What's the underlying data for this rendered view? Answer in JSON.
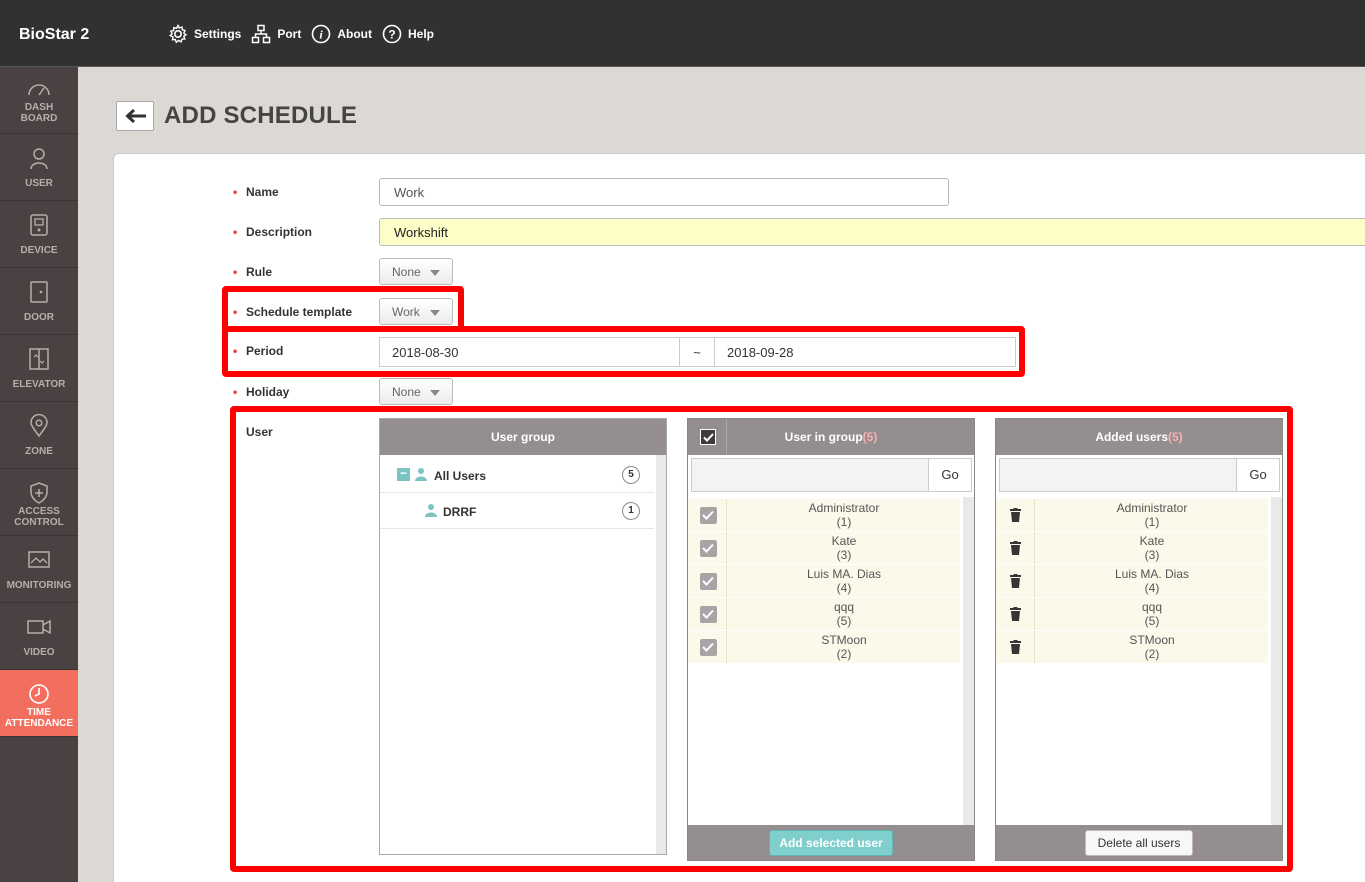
{
  "app": {
    "title": "BioStar 2"
  },
  "topnav": {
    "settings": "Settings",
    "port": "Port",
    "about": "About",
    "help": "Help"
  },
  "sidebar": {
    "items": [
      {
        "line1": "DASH",
        "line2": "BOARD",
        "icon": "dashboard-icon"
      },
      {
        "line1": "USER",
        "line2": "",
        "icon": "user-icon"
      },
      {
        "line1": "DEVICE",
        "line2": "",
        "icon": "device-icon"
      },
      {
        "line1": "DOOR",
        "line2": "",
        "icon": "door-icon"
      },
      {
        "line1": "ELEVATOR",
        "line2": "",
        "icon": "elevator-icon"
      },
      {
        "line1": "ZONE",
        "line2": "",
        "icon": "zone-icon"
      },
      {
        "line1": "ACCESS",
        "line2": "CONTROL",
        "icon": "access-control-icon"
      },
      {
        "line1": "MONITORING",
        "line2": "",
        "icon": "monitoring-icon"
      },
      {
        "line1": "VIDEO",
        "line2": "",
        "icon": "video-icon"
      },
      {
        "line1": "TIME",
        "line2": "ATTENDANCE",
        "icon": "clock-icon",
        "active": true
      }
    ]
  },
  "page": {
    "title": "ADD SCHEDULE"
  },
  "form": {
    "name_label": "Name",
    "name_value": "Work",
    "description_label": "Description",
    "description_value": "Workshift",
    "rule_label": "Rule",
    "rule_value": "None",
    "template_label": "Schedule template",
    "template_value": "Work",
    "period_label": "Period",
    "period_start": "2018-08-30",
    "period_sep": "~",
    "period_end": "2018-09-28",
    "holiday_label": "Holiday",
    "holiday_value": "None",
    "user_label": "User",
    "required_mark": "•"
  },
  "user_group": {
    "header": "User group",
    "tree": [
      {
        "label": "All Users",
        "count": "5",
        "collapse": "−"
      },
      {
        "label": "DRRF",
        "count": "1"
      }
    ]
  },
  "user_in_group": {
    "header": "User in group",
    "count": "(5)",
    "go_label": "Go",
    "users": [
      {
        "name": "Administrator",
        "id": "(1)"
      },
      {
        "name": "Kate",
        "id": "(3)"
      },
      {
        "name": "Luis MA. Dias",
        "id": "(4)"
      },
      {
        "name": "qqq",
        "id": "(5)"
      },
      {
        "name": "STMoon",
        "id": "(2)"
      }
    ],
    "button": "Add selected user"
  },
  "added_users": {
    "header": "Added users",
    "count": "(5)",
    "go_label": "Go",
    "users": [
      {
        "name": "Administrator",
        "id": "(1)"
      },
      {
        "name": "Kate",
        "id": "(3)"
      },
      {
        "name": "Luis MA. Dias",
        "id": "(4)"
      },
      {
        "name": "qqq",
        "id": "(5)"
      },
      {
        "name": "STMoon",
        "id": "(2)"
      }
    ],
    "button": "Delete all users"
  },
  "colors": {
    "topbar": "#333030",
    "sidebar": "#4a4142",
    "active": "#f26f5f",
    "highlight": "#ff0000",
    "header_gray": "#958e90",
    "teal_button": "#7fcfcc"
  }
}
